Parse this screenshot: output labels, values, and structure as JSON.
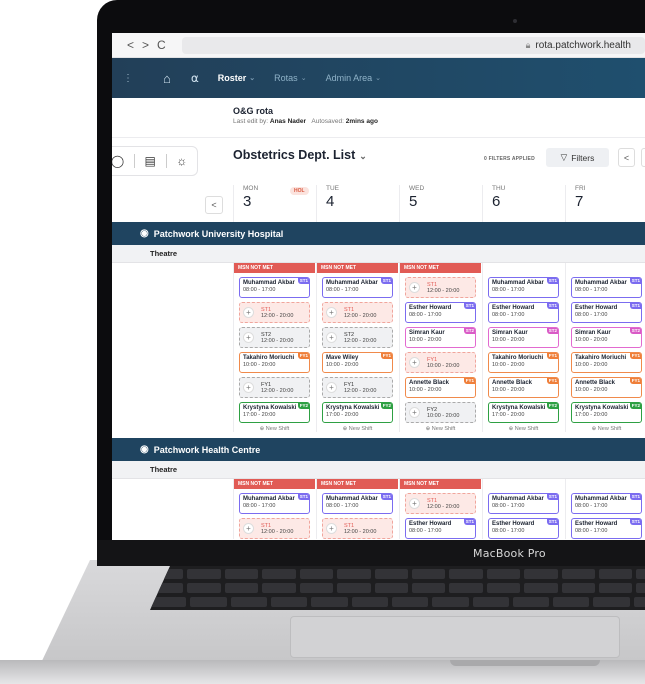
{
  "device": {
    "label": "MacBook Pro"
  },
  "browser": {
    "nav_back": "<",
    "nav_forward": ">",
    "reload": "C",
    "url": "rota.patchwork.health"
  },
  "appnav": {
    "roster": "Roster",
    "rotas": "Rotas",
    "admin": "Admin Area"
  },
  "titlebar": {
    "title": "O&G rota",
    "last_edit_prefix": "Last edit by:",
    "editor": "Anas Nader",
    "autosaved_prefix": "Autosaved:",
    "autosaved": "2mins ago"
  },
  "toolbar": {
    "list_title": "Obstetrics Dept. List",
    "filters_applied": "0 FILTERS APPLIED",
    "filters": "Filters",
    "prev": "<"
  },
  "days": [
    {
      "name": "MON",
      "date": "3",
      "badge": "HOL"
    },
    {
      "name": "TUE",
      "date": "4"
    },
    {
      "name": "WED",
      "date": "5"
    },
    {
      "name": "THU",
      "date": "6"
    },
    {
      "name": "FRI",
      "date": "7"
    }
  ],
  "new_shift_label": "New Shift",
  "msn_label": "MSN NOT MET",
  "sections": [
    {
      "hospital": "Patchwork University Hospital",
      "location": "Theatre",
      "columns": [
        {
          "msn": true,
          "shifts": [
            {
              "kind": "filled",
              "color": "purple",
              "tag": "ST1",
              "name": "Muhammad Akbar",
              "time": "08:00 - 17:00"
            },
            {
              "kind": "open",
              "red": true,
              "role": "ST1",
              "time": "12:00 - 20:00"
            },
            {
              "kind": "open",
              "red": false,
              "role": "ST2",
              "time": "12:00 - 20:00"
            },
            {
              "kind": "filled",
              "color": "orange",
              "tag": "FY1",
              "name": "Takahiro Moriuchi",
              "time": "10:00 - 20:00"
            },
            {
              "kind": "open",
              "red": false,
              "role": "FY1",
              "time": "12:00 - 20:00"
            },
            {
              "kind": "filled",
              "color": "green",
              "tag": "FY2",
              "name": "Krystyna Kowalski",
              "time": "17:00 - 20:00"
            }
          ]
        },
        {
          "msn": true,
          "shifts": [
            {
              "kind": "filled",
              "color": "purple",
              "tag": "ST1",
              "name": "Muhammad Akbar",
              "time": "08:00 - 17:00"
            },
            {
              "kind": "open",
              "red": true,
              "role": "ST1",
              "time": "12:00 - 20:00"
            },
            {
              "kind": "open",
              "red": false,
              "role": "ST2",
              "time": "12:00 - 20:00"
            },
            {
              "kind": "filled",
              "color": "orange",
              "tag": "FY1",
              "name": "Mave Wiley",
              "time": "10:00 - 20:00"
            },
            {
              "kind": "open",
              "red": false,
              "role": "FY1",
              "time": "12:00 - 20:00"
            },
            {
              "kind": "filled",
              "color": "green",
              "tag": "FY2",
              "name": "Krystyna Kowalski",
              "time": "17:00 - 20:00"
            }
          ]
        },
        {
          "msn": true,
          "shifts": [
            {
              "kind": "open",
              "red": true,
              "role": "ST1",
              "time": "12:00 - 20:00"
            },
            {
              "kind": "filled",
              "color": "purple",
              "tag": "ST1",
              "name": "Esther Howard",
              "time": "08:00 - 17:00"
            },
            {
              "kind": "filled",
              "color": "pink",
              "tag": "ST2",
              "name": "Simran Kaur",
              "time": "10:00 - 20:00"
            },
            {
              "kind": "open",
              "red": true,
              "role": "FY1",
              "time": "10:00 - 20:00"
            },
            {
              "kind": "filled",
              "color": "orange",
              "tag": "FY1",
              "name": "Annette Black",
              "time": "10:00 - 20:00"
            },
            {
              "kind": "open",
              "red": false,
              "role": "FY2",
              "time": "10:00 - 20:00"
            }
          ]
        },
        {
          "msn": false,
          "shifts": [
            {
              "kind": "filled",
              "color": "purple",
              "tag": "ST1",
              "name": "Muhammad Akbar",
              "time": "08:00 - 17:00"
            },
            {
              "kind": "filled",
              "color": "purple",
              "tag": "ST1",
              "name": "Esther Howard",
              "time": "08:00 - 17:00"
            },
            {
              "kind": "filled",
              "color": "pink",
              "tag": "ST2",
              "name": "Simran Kaur",
              "time": "10:00 - 20:00"
            },
            {
              "kind": "filled",
              "color": "orange",
              "tag": "FY1",
              "name": "Takahiro Moriuchi",
              "time": "10:00 - 20:00"
            },
            {
              "kind": "filled",
              "color": "orange",
              "tag": "FY1",
              "name": "Annette Black",
              "time": "10:00 - 20:00"
            },
            {
              "kind": "filled",
              "color": "green",
              "tag": "FY2",
              "name": "Krystyna Kowalski",
              "time": "17:00 - 20:00"
            }
          ]
        },
        {
          "msn": false,
          "shifts": [
            {
              "kind": "filled",
              "color": "purple",
              "tag": "ST1",
              "name": "Muhammad Akbar",
              "time": "08:00 - 17:00"
            },
            {
              "kind": "filled",
              "color": "purple",
              "tag": "ST1",
              "name": "Esther Howard",
              "time": "08:00 - 17:00"
            },
            {
              "kind": "filled",
              "color": "pink",
              "tag": "ST2",
              "name": "Simran Kaur",
              "time": "10:00 - 20:00"
            },
            {
              "kind": "filled",
              "color": "orange",
              "tag": "FY1",
              "name": "Takahiro Moriuchi",
              "time": "10:00 - 20:00"
            },
            {
              "kind": "filled",
              "color": "orange",
              "tag": "FY1",
              "name": "Annette Black",
              "time": "10:00 - 20:00"
            },
            {
              "kind": "filled",
              "color": "green",
              "tag": "FY2",
              "name": "Krystyna Kowalski",
              "time": "17:00 - 20:00"
            }
          ]
        }
      ]
    },
    {
      "hospital": "Patchwork Health Centre",
      "location": "Theatre",
      "columns": [
        {
          "msn": true,
          "shifts": [
            {
              "kind": "filled",
              "color": "purple",
              "tag": "ST1",
              "name": "Muhammad Akbar",
              "time": "08:00 - 17:00"
            },
            {
              "kind": "open",
              "red": true,
              "role": "ST1",
              "time": "12:00 - 20:00"
            }
          ]
        },
        {
          "msn": true,
          "shifts": [
            {
              "kind": "filled",
              "color": "purple",
              "tag": "ST1",
              "name": "Muhammad Akbar",
              "time": "08:00 - 17:00"
            },
            {
              "kind": "open",
              "red": true,
              "role": "ST1",
              "time": "12:00 - 20:00"
            }
          ]
        },
        {
          "msn": true,
          "shifts": [
            {
              "kind": "open",
              "red": true,
              "role": "ST1",
              "time": "12:00 - 20:00"
            },
            {
              "kind": "filled",
              "color": "purple",
              "tag": "ST1",
              "name": "Esther Howard",
              "time": "08:00 - 17:00"
            }
          ]
        },
        {
          "msn": false,
          "shifts": [
            {
              "kind": "filled",
              "color": "purple",
              "tag": "ST1",
              "name": "Muhammad Akbar",
              "time": "08:00 - 17:00"
            },
            {
              "kind": "filled",
              "color": "purple",
              "tag": "ST1",
              "name": "Esther Howard",
              "time": "08:00 - 17:00"
            }
          ]
        },
        {
          "msn": false,
          "shifts": [
            {
              "kind": "filled",
              "color": "purple",
              "tag": "ST1",
              "name": "Muhammad Akbar",
              "time": "08:00 - 17:00"
            },
            {
              "kind": "filled",
              "color": "purple",
              "tag": "ST1",
              "name": "Esther Howard",
              "time": "08:00 - 17:00"
            }
          ]
        }
      ]
    }
  ]
}
